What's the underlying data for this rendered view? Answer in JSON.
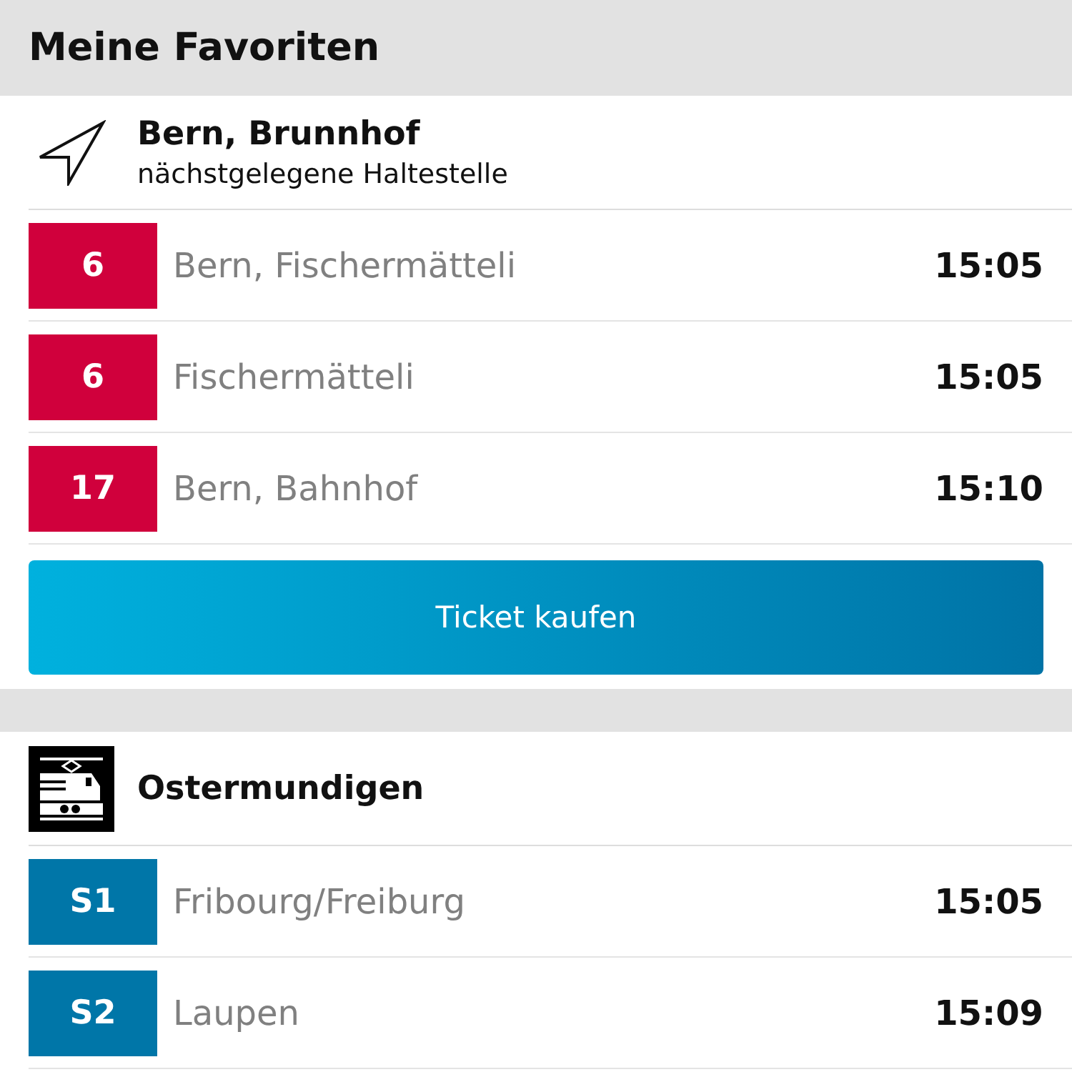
{
  "title": "Meine Favoriten",
  "stops": [
    {
      "kind": "nearby",
      "name": "Bern, Brunnhof",
      "subtitle": "nächstgelegene Haltestelle",
      "departures": [
        {
          "line": "6",
          "color": "#d0003c",
          "destination": "Bern, Fischermätteli",
          "time": "15:05"
        },
        {
          "line": "6",
          "color": "#d0003c",
          "destination": "Fischermätteli",
          "time": "15:05"
        },
        {
          "line": "17",
          "color": "#d0003c",
          "destination": "Bern, Bahnhof",
          "time": "15:10"
        }
      ],
      "button": "Ticket kaufen"
    },
    {
      "kind": "train",
      "name": "Ostermundigen",
      "departures": [
        {
          "line": "S1",
          "color": "#0076a8",
          "destination": "Fribourg/Freiburg",
          "time": "15:05"
        },
        {
          "line": "S2",
          "color": "#0076a8",
          "destination": "Laupen",
          "time": "15:09"
        }
      ]
    }
  ]
}
